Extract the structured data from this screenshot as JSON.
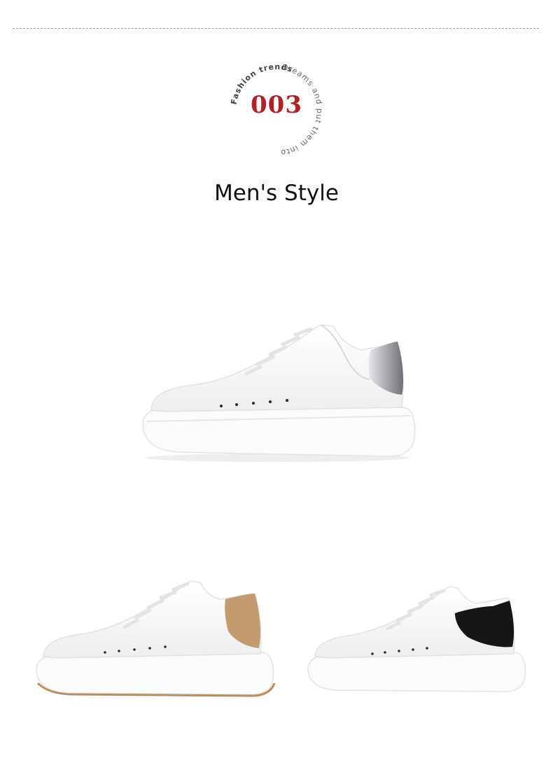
{
  "header": {
    "divider": "dashed",
    "badge": {
      "number": "003",
      "ring_text_top": "Dreams and put them into",
      "ring_text_bottom": "Fashion trends",
      "number_color": "#b32025"
    }
  },
  "main": {
    "title": "Men's Style"
  },
  "products": [
    {
      "variant": "silver-heel",
      "heel_color": "#a9abae"
    },
    {
      "variant": "tan-heel",
      "heel_color": "#c49a70"
    },
    {
      "variant": "black-heel",
      "heel_color": "#161616"
    }
  ]
}
